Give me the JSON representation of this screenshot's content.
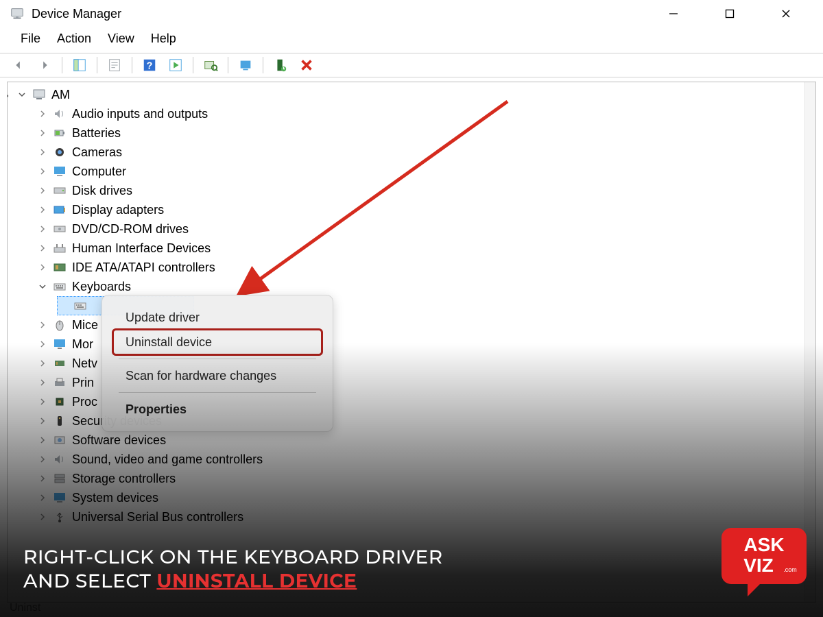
{
  "window": {
    "title": "Device Manager"
  },
  "menu": {
    "file": "File",
    "action": "Action",
    "view": "View",
    "help": "Help"
  },
  "tree": {
    "root": "AM",
    "audio": "Audio inputs and outputs",
    "batteries": "Batteries",
    "cameras": "Cameras",
    "computer": "Computer",
    "disk": "Disk drives",
    "display": "Display adapters",
    "dvd": "DVD/CD-ROM drives",
    "hid": "Human Interface Devices",
    "ide": "IDE ATA/ATAPI controllers",
    "keyboards": "Keyboards",
    "keyboard_item": "",
    "mice": "Mice",
    "monitors": "Mor",
    "network": "Netv",
    "printers": "Prin",
    "processors": "Proc",
    "security": "Security devices",
    "software": "Software devices",
    "sound": "Sound, video and game controllers",
    "storage": "Storage controllers",
    "system": "System devices",
    "usb": "Universal Serial Bus controllers"
  },
  "context_menu": {
    "update": "Update driver",
    "uninstall": "Uninstall device",
    "scan": "Scan for hardware changes",
    "properties": "Properties"
  },
  "caption": {
    "line1": "RIGHT-CLICK ON THE KEYBOARD DRIVER",
    "line2a": "AND SELECT ",
    "emph": "UNINSTALL DEVICE"
  },
  "badge": {
    "l1": "ASK",
    "l2": "VIZ",
    "dot": ".com"
  },
  "status": "Uninst"
}
